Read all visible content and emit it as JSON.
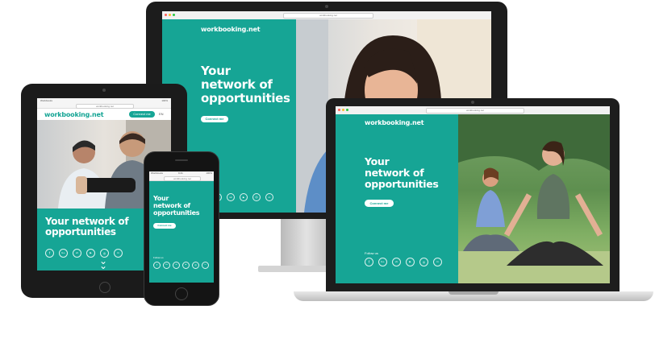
{
  "brand": {
    "name": "workbooking.net",
    "accent": "#16a595"
  },
  "hero": {
    "headline_l1": "Your",
    "headline_l2": "network of",
    "headline_l3": "opportunities",
    "headline_inline": "Your network of opportunities",
    "cta_label": "Connect me"
  },
  "browser": {
    "url": "workbooking.net"
  },
  "tablet": {
    "status_left": "Workbooks",
    "status_right": "100%",
    "nav_button": "Connect me",
    "lang": "EN"
  },
  "phone": {
    "status_left": "Workbooks",
    "status_time": "9:41",
    "status_right": "100%",
    "follow_label": "Follow us"
  },
  "laptop": {
    "follow_label": "Follow us"
  },
  "social": {
    "icons": [
      "facebook-icon",
      "google-plus-icon",
      "vk-icon",
      "youtube-icon",
      "instagram-icon",
      "linkedin-icon"
    ],
    "glyphs": [
      "f",
      "G+",
      "vk",
      "▶",
      "◎",
      "in"
    ]
  }
}
